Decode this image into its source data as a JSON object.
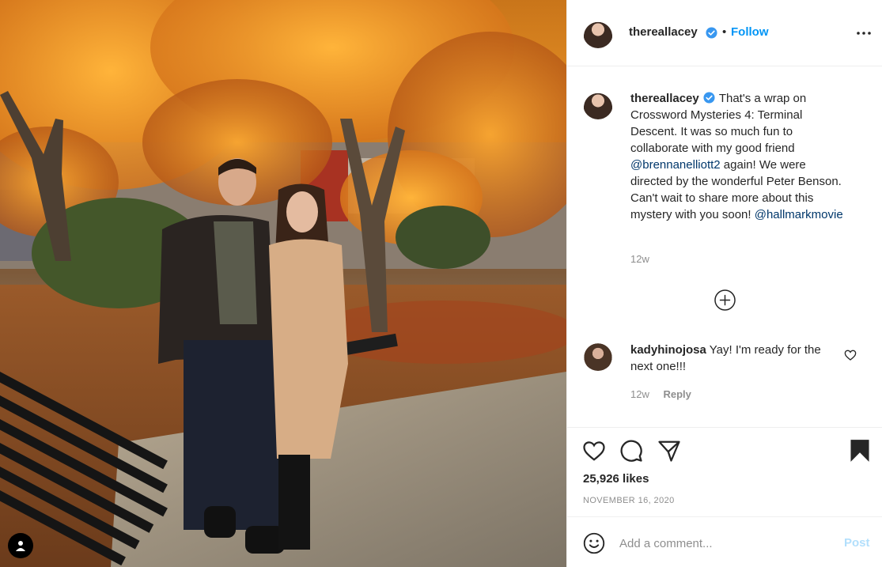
{
  "post": {
    "username": "thereallacey",
    "follow_label": "Follow",
    "separator": "•",
    "caption_parts": {
      "text1": "That's a wrap on Crossword Mysteries 4: Terminal Descent. It was so much fun to collaborate with my good friend ",
      "mention1": "@brennanelliott2",
      "text2": " again! We were directed by the wonderful Peter Benson. Can't wait to share more about this mystery with you soon! ",
      "mention2": "@hallmarkmovie"
    },
    "caption_time": "12w",
    "likes": "25,926 likes",
    "date": "NOVEMBER 16, 2020"
  },
  "comments": [
    {
      "username": "kadyhinojosa",
      "text": "Yay! I'm ready for the next one!!!",
      "time": "12w",
      "reply_label": "Reply"
    }
  ],
  "composer": {
    "placeholder": "Add a comment...",
    "post_label": "Post"
  },
  "icons": {
    "more": "more-options-icon",
    "verified": "verified-badge-icon",
    "load_more": "plus-circle-icon",
    "like": "heart-icon",
    "comment": "comment-bubble-icon",
    "share": "paper-plane-icon",
    "save": "bookmark-icon",
    "emoji": "emoji-smiley-icon",
    "tag": "user-tag-icon"
  },
  "colors": {
    "accent": "#0095f6",
    "text": "#262626",
    "muted": "#8e8e8e",
    "mention": "#00376b",
    "post_disabled": "#b2dffc"
  }
}
